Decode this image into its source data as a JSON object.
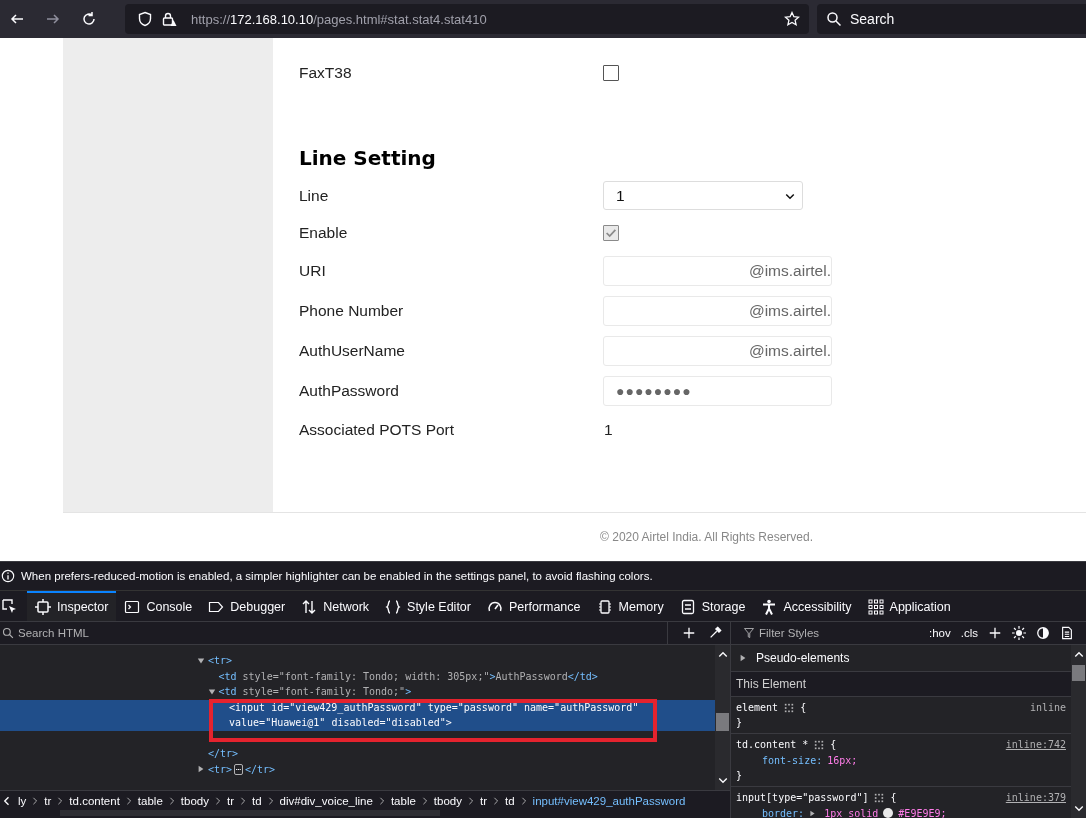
{
  "browser": {
    "url_parts": [
      {
        "text": "https://",
        "highlight": false
      },
      {
        "text": "172.168.10.10",
        "highlight": true
      },
      {
        "text": "/pages.html#stat.stat4.stat410",
        "highlight": false
      }
    ],
    "search_placeholder": "Search"
  },
  "page": {
    "rows": [
      {
        "kind": "checkbox",
        "label": "FaxT38",
        "checked": false,
        "disabled": false
      },
      {
        "kind": "heading",
        "label": "Line Setting"
      },
      {
        "kind": "select",
        "label": "Line",
        "value": "1"
      },
      {
        "kind": "checkbox",
        "label": "Enable",
        "checked": true,
        "disabled": true
      },
      {
        "kind": "field",
        "label": "URI",
        "value": "@ims.airtel."
      },
      {
        "kind": "field",
        "label": "Phone Number",
        "value": "@ims.airtel."
      },
      {
        "kind": "field",
        "label": "AuthUserName",
        "value": "@ims.airtel."
      },
      {
        "kind": "password",
        "label": "AuthPassword",
        "value": "●●●●●●●●"
      },
      {
        "kind": "text",
        "label": "Associated POTS Port",
        "value": "1"
      }
    ],
    "footer": "© 2020 Airtel India. All Rights Reserved."
  },
  "devtools": {
    "notice": "When prefers-reduced-motion is enabled, a simpler highlighter can be enabled in the settings panel, to avoid flashing colors.",
    "tabs": [
      {
        "label": "Inspector",
        "selected": true
      },
      {
        "label": "Console",
        "selected": false
      },
      {
        "label": "Debugger",
        "selected": false
      },
      {
        "label": "Network",
        "selected": false
      },
      {
        "label": "Style Editor",
        "selected": false
      },
      {
        "label": "Performance",
        "selected": false
      },
      {
        "label": "Memory",
        "selected": false
      },
      {
        "label": "Storage",
        "selected": false
      },
      {
        "label": "Accessibility",
        "selected": false
      },
      {
        "label": "Application",
        "selected": false
      }
    ],
    "search_placeholder": "Search HTML",
    "filter_placeholder": "Filter Styles",
    "style_buttons": [
      ":hov",
      ".cls"
    ],
    "markup": [
      {
        "open": "<tr>",
        "close": "</tr>",
        "expanded": true,
        "children": [
          {
            "open": "<td style=\"font-family: Tondo; width: 305px;\">AuthPassword</td>"
          },
          {
            "open": "<td style=\"font-family: Tondo;\">",
            "expanded": true,
            "children": [
              {
                "open": "<input id=\"view429_authPassword\" type=\"password\" name=\"authPassword\"",
                "open_2": "value=\"Huawei@1\" disabled=\"disabled\">",
                "selected": true
              }
            ]
          }
        ]
      },
      {
        "open": "<tr>",
        "close": "</tr>",
        "expanded": false,
        "badge": "⋯"
      }
    ],
    "breadcrumbs": [
      {
        "label": "ly",
        "selected": false
      },
      {
        "label": "tr",
        "selected": false
      },
      {
        "label": "td.content",
        "selected": false
      },
      {
        "label": "table",
        "selected": false
      },
      {
        "label": "tbody",
        "selected": false
      },
      {
        "label": "tr",
        "selected": false
      },
      {
        "label": "td",
        "selected": false
      },
      {
        "label": "div#div_voice_line",
        "selected": false
      },
      {
        "label": "table",
        "selected": false
      },
      {
        "label": "tbody",
        "selected": false
      },
      {
        "label": "tr",
        "selected": false
      },
      {
        "label": "td",
        "selected": false
      },
      {
        "label": "input#view429_authPassword",
        "selected": true
      }
    ],
    "pseudo": "Pseudo-elements",
    "this_element": "This Element",
    "rules": [
      {
        "selector": "element",
        "open": "{",
        "source": "inline",
        "close": "}"
      },
      {
        "selector": "td.content *",
        "open": "{",
        "source": "inline:742",
        "decls": [
          {
            "prop": "font-size:",
            "value": "16px;"
          }
        ],
        "close": "}"
      },
      {
        "selector": "input[type=\"password\"]",
        "open": "{",
        "source": "inline:379",
        "decls": [
          {
            "prop": "border:",
            "value": "1px solid",
            "color": "#e9e9e9",
            "value_2": "#E9E9E9;"
          }
        ]
      }
    ]
  }
}
